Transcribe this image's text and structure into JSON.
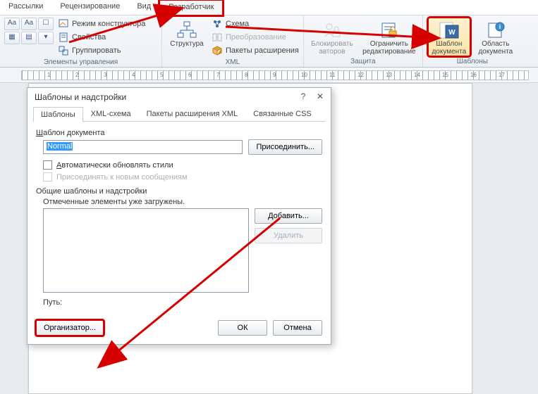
{
  "tabs": {
    "mailings": "Рассылки",
    "review": "Рецензирование",
    "view": "Вид",
    "developer": "Разработчик"
  },
  "ribbon": {
    "controls_small": [
      "Aa",
      "Aa",
      "☐",
      "▦",
      "▤",
      "▾"
    ],
    "controls_cmds": {
      "design_mode": "Режим конструктора",
      "properties": "Свойства",
      "group": "Группировать"
    },
    "controls_group": "Элементы управления",
    "structure_btn": "Структура",
    "xml_cmds": {
      "schema": "Схема",
      "transformation": "Преобразование",
      "expansion_packs": "Пакеты расширения"
    },
    "xml_group": "XML",
    "block_authors_btn": "Блокировать\nавторов",
    "restrict_btn": "Ограничить\nредактирование",
    "protect_group": "Защита",
    "template_btn": "Шаблон\nдокумента",
    "region_btn": "Область\nдокумента",
    "templates_group": "Шаблоны"
  },
  "ruler": {
    "nums": [
      "1",
      "2",
      "3",
      "4",
      "5",
      "6",
      "7",
      "8",
      "9",
      "10",
      "11",
      "12",
      "13",
      "14",
      "15",
      "16",
      "17"
    ]
  },
  "dlg": {
    "title": "Шаблоны и надстройки",
    "tabs": {
      "templates": "Шаблоны",
      "xml_schema": "XML-схема",
      "expansion": "Пакеты расширения XML",
      "css": "Связанные CSS"
    },
    "doc_template_label": "Шаблон документа",
    "doc_template_value": "Normal",
    "attach_btn": "Присоединить...",
    "auto_update": "Автоматически обновлять стили",
    "attach_new_msg": "Присоединять к новым сообщениям",
    "globals_label": "Общие шаблоны и надстройки",
    "marked_label": "Отмеченные элементы уже загружены.",
    "add_btn": "Добавить...",
    "remove_btn": "Удалить",
    "path_label": "Путь:",
    "organizer_btn": "Организатор...",
    "ok_btn": "ОК",
    "cancel_btn": "Отмена"
  }
}
